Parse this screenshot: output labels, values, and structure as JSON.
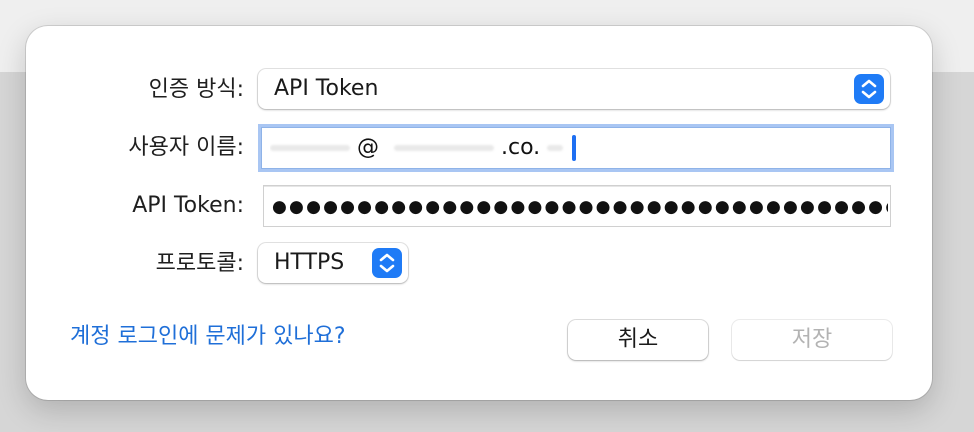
{
  "dialog": {
    "auth_method": {
      "label": "인증 방식:",
      "selected": "API Token"
    },
    "username": {
      "label": "사용자 이름:",
      "at_sign": "@",
      "domain_suffix": ".co."
    },
    "api_token": {
      "label": "API Token:",
      "masked_value": "●●●●●●●●●●●●●●●●●●●●●●●●●●●●●●●●●●●●●●"
    },
    "protocol": {
      "label": "프로토콜:",
      "selected": "HTTPS"
    },
    "help_link": "계정 로그인에 문제가 있나요?",
    "cancel_label": "취소",
    "save_label": "저장"
  },
  "colors": {
    "accent": "#1f7bf6",
    "link": "#1f6fd8",
    "focus_ring": "#a9c6f3",
    "disabled_text": "#b3b3b3"
  }
}
